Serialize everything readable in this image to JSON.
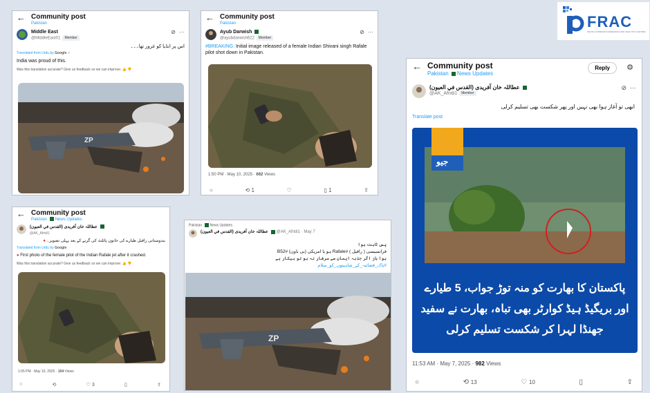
{
  "logo": {
    "text": "FRAC",
    "subtext": "DIGITAL FORENSICS RESEARCH AND ANALYTICS CENTRE",
    "brand_color": "#1d5fb8"
  },
  "card1": {
    "title": "Community post",
    "subtitle": "Pakistan",
    "user_name": "Middle East",
    "user_handle": "@MiddleEast01",
    "badge": "Member",
    "urdu_text": "اس پر انڈیا کو غرور تھا۔۔۔",
    "translated_label": "Translated from Urdu by",
    "google": "Google",
    "translation": "India was proud of this.",
    "feedback": "Was this translation accurate? Give us feedback so we can improve:",
    "image_label": "ZP"
  },
  "card2": {
    "title": "Community post",
    "subtitle": "Pakistan",
    "user_name": "Ayub Darwish",
    "user_handle": "@ayubdarwish622",
    "badge": "Member",
    "hashtag": "#BREAKING:",
    "text": "Initial image released of a female Indian Shivani singh Rafale pilot shot down in Pakistan.",
    "time": "1:50 PM · May 10, 2025 ·",
    "views_count": "662",
    "views_label": "Views",
    "reply_count": "",
    "repost_count": "1",
    "like_count": "",
    "bookmark_count": "1"
  },
  "card3": {
    "title": "Community post",
    "subtitle": "Pakistan",
    "subtitle2": "News Updates",
    "reply": "Reply",
    "user_name": "عطاللہ خان آفریدی (القدس في العيون)",
    "user_handle": "@AK_Afridi1",
    "badge": "Member",
    "urdu_text": "ابھی تو آغاز ہوا بھی نہیں اور پھر شکست بھی تسلیم کرلی",
    "translate": "Translate post",
    "geo": "جیو",
    "headline1": "پاکستان کا بھارت کو منہ توڑ جواب، 5 طیارے",
    "headline2": "اور بریگیڈ ہیڈ کوارٹر بھی تباہ، بھارت نے سفید",
    "headline3": "جھنڈا لہرا کر شکست تسلیم کرلی",
    "time": "11:53 AM · May 7, 2025 ·",
    "views_count": "982",
    "views_label": "Views",
    "repost_count": "13",
    "like_count": "10"
  },
  "card4": {
    "title": "Community post",
    "subtitle": "Pakistan",
    "subtitle2": "News Updates",
    "user_name": "عطاللہ خان آفریدی (القدس في العيون)",
    "user_handle": "@AK_Afridi1",
    "urdu_text": "بندوستانی رافیل طیارے کی خاتون پائلٹ کی گرنے کے بعد پہلی تصویر۔",
    "translated_label": "Translated from Urdu by",
    "google": "Google",
    "translation": "First photo of the female pilot of the Indian Rafale jet after it crashed.",
    "feedback": "Was this translation accurate? Give us feedback so we can improve:",
    "time": "1:05 PM · May 10, 2025 ·",
    "views_count": "104",
    "views_label": "Views",
    "like_count": "3"
  },
  "card5": {
    "tag1": "Pakistan",
    "tag2": "News Updates",
    "user_name": "عطاللہ خان آفریدی (القدس في العيون)",
    "user_handle": "@AK_Afridi1 · May 7",
    "line1": "پس ثابت ہوا",
    "line2": "فرانسیسی ( رافیل ) #Rafale ہو یا امریکی (بی باون) #B52",
    "line3": "ہوا باز اگر جذبہ ایمان سے سرشار نہ ہو تو بیکار ہے",
    "line4": "#پاک_فضائیہ_کے_شاہینوں_کو_سلام",
    "image_label": "ZP"
  }
}
